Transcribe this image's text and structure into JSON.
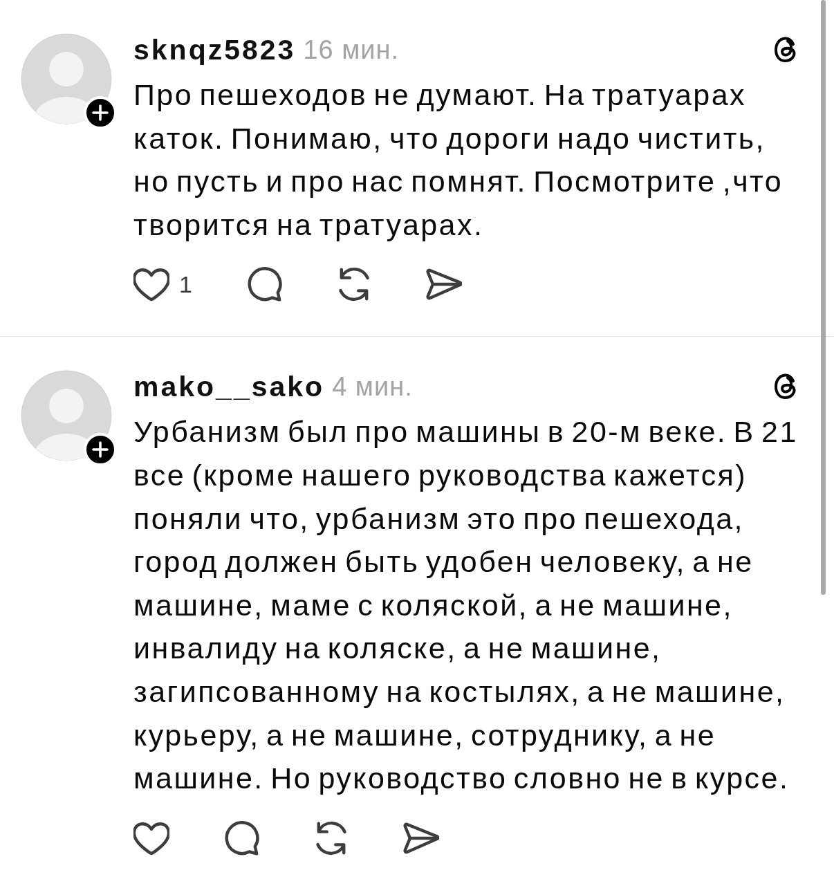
{
  "posts": [
    {
      "username": "sknqz5823",
      "time": "16 мин.",
      "text": "Про пешеходов не думают. На тратуарах каток. Понимаю, что дороги надо чистить, но пусть и про нас помнят. Посмотрите ,что творится на тратуарах.",
      "actions": [
        {
          "kind": "like",
          "count": "1"
        },
        {
          "kind": "reply"
        },
        {
          "kind": "repost"
        },
        {
          "kind": "share"
        }
      ]
    },
    {
      "username": "mako__sako",
      "time": "4 мин.",
      "text": "Урбанизм был про машины в 20-м веке. В 21 все (кроме нашего руководства кажется) поняли что, урбанизм это про пешехода, город должен быть удобен человеку, а не машине, маме с коляской, а не машине, инвалиду на коляске, а не машине, загипсованному на костылях, а не машине, курьеру, а не машине, сотруднику, а не машине. Но руководство словно не в курсе.",
      "actions": [
        {
          "kind": "like"
        },
        {
          "kind": "reply"
        },
        {
          "kind": "repost"
        },
        {
          "kind": "share"
        }
      ]
    }
  ]
}
